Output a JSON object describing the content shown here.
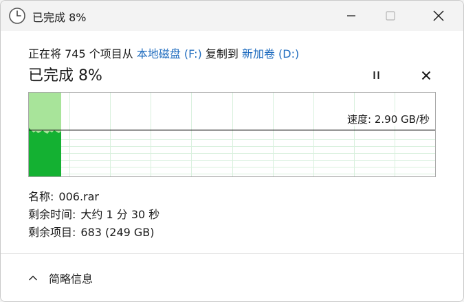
{
  "window": {
    "title": "已完成 8%",
    "icons": {
      "app": "clock-icon",
      "minimize": "minimize-icon",
      "maximize": "maximize-icon",
      "close": "close-icon"
    }
  },
  "copy": {
    "prefix": "正在将 745 个项目从 ",
    "source": "本地磁盘 (F:)",
    "middle": " 复制到 ",
    "destination": "新加卷 (D:)",
    "status": "已完成 8%",
    "percent": 8,
    "pause_icon": "pause-icon",
    "cancel_icon": "cancel-icon"
  },
  "graph": {
    "speed_text": "速度: 2.90 GB/秒",
    "progress_fraction": 0.08,
    "colors": {
      "fill_done": "#a8e49a",
      "fill_speed": "#14b132",
      "grid": "#d8f0dd",
      "speed_line": "#1a1a1a"
    }
  },
  "details": [
    {
      "label": "名称:",
      "value": "006.rar"
    },
    {
      "label": "剩余时间:",
      "value": "大约 1 分 30 秒"
    },
    {
      "label": "剩余项目:",
      "value": "683 (249 GB)"
    }
  ],
  "footer": {
    "toggle_label": "简略信息",
    "toggle_icon": "chevron-up-icon"
  },
  "accent": "#1f6cbf"
}
